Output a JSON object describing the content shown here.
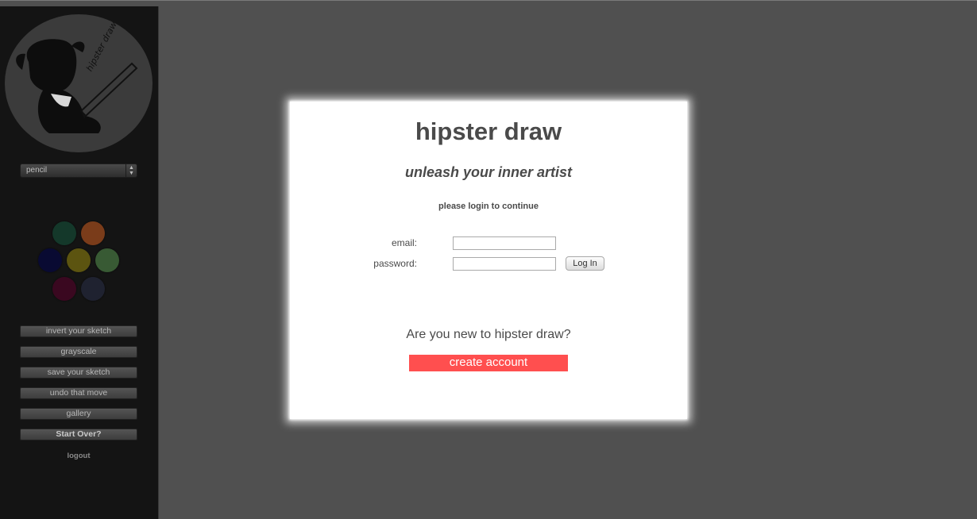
{
  "sidebar": {
    "logo_text": "hipster draw",
    "tool_select": {
      "value": "pencil"
    },
    "swatches": [
      {
        "name": "swatch-dark-green",
        "color": "#14382a"
      },
      {
        "name": "swatch-orange",
        "color": "#7a3c1a"
      },
      {
        "name": "swatch-navy",
        "color": "#090a32"
      },
      {
        "name": "swatch-yellow",
        "color": "#5c5410"
      },
      {
        "name": "swatch-light-green",
        "color": "#385a34"
      },
      {
        "name": "swatch-magenta",
        "color": "#3a0820"
      },
      {
        "name": "swatch-slate",
        "color": "#1f2230"
      }
    ],
    "buttons": {
      "invert": "invert your sketch",
      "grayscale": "grayscale",
      "save": "save your sketch",
      "undo": "undo that move",
      "gallery": "gallery",
      "start_over": "Start Over?"
    },
    "logout": "logout"
  },
  "modal": {
    "title": "hipster draw",
    "subtitle": "unleash your inner artist",
    "note": "please login to continue",
    "email_label": "email:",
    "email_value": "",
    "password_label": "password:",
    "password_value": "",
    "login_button": "Log In",
    "new_user_prompt": "Are you new to hipster draw?",
    "create_account_button": "create account"
  },
  "colors": {
    "background": "#505050",
    "sidebar": "#141414",
    "accent": "#ff4f4f"
  }
}
